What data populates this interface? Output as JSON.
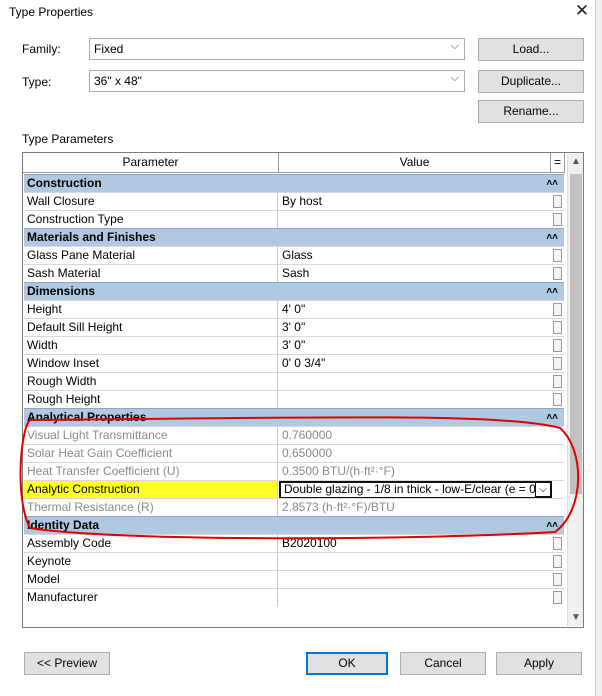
{
  "window": {
    "title": "Type Properties",
    "close_glyph": "✕"
  },
  "family": {
    "label": "Family:",
    "value": "Fixed"
  },
  "type": {
    "label": "Type:",
    "value": "36\" x 48\""
  },
  "buttons": {
    "load": "Load...",
    "duplicate": "Duplicate...",
    "rename": "Rename..."
  },
  "section_label": "Type Parameters",
  "table": {
    "col_parameter": "Parameter",
    "col_value": "Value",
    "col_extra": "="
  },
  "groups": [
    {
      "name": "Construction",
      "rows": [
        {
          "param": "Wall Closure",
          "value": "By host"
        },
        {
          "param": "Construction Type",
          "value": ""
        }
      ]
    },
    {
      "name": "Materials and Finishes",
      "rows": [
        {
          "param": "Glass Pane Material",
          "value": "Glass"
        },
        {
          "param": "Sash Material",
          "value": "Sash"
        }
      ]
    },
    {
      "name": "Dimensions",
      "rows": [
        {
          "param": "Height",
          "value": "4'  0\""
        },
        {
          "param": "Default Sill Height",
          "value": "3'  0\""
        },
        {
          "param": "Width",
          "value": "3'  0\""
        },
        {
          "param": "Window Inset",
          "value": "0'  0 3/4\""
        },
        {
          "param": "Rough Width",
          "value": ""
        },
        {
          "param": "Rough Height",
          "value": ""
        }
      ]
    },
    {
      "name": "Analytical Properties",
      "rows": [
        {
          "param": "Visual Light Transmittance",
          "value": "0.760000"
        },
        {
          "param": "Solar Heat Gain Coefficient",
          "value": "0.650000"
        },
        {
          "param": "Heat Transfer Coefficient (U)",
          "value": "0.3500 BTU/(h·ft²·°F)"
        },
        {
          "param": "Analytic Construction",
          "value": "Double glazing - 1/8 in thick - low-E/clear (e = 0"
        },
        {
          "param": "Thermal Resistance (R)",
          "value": "2.8573 (h·ft²·°F)/BTU"
        }
      ]
    },
    {
      "name": "Identity Data",
      "rows": [
        {
          "param": "Assembly Code",
          "value": "B2020100"
        },
        {
          "param": "Keynote",
          "value": ""
        },
        {
          "param": "Model",
          "value": ""
        },
        {
          "param": "Manufacturer",
          "value": ""
        }
      ]
    }
  ],
  "footer": {
    "preview": "<< Preview",
    "ok": "OK",
    "cancel": "Cancel",
    "apply": "Apply"
  },
  "colors": {
    "group_header": "#b0c8e0",
    "highlight": "#ffff2a",
    "annotation": "#e00000",
    "accent": "#0078d7"
  }
}
